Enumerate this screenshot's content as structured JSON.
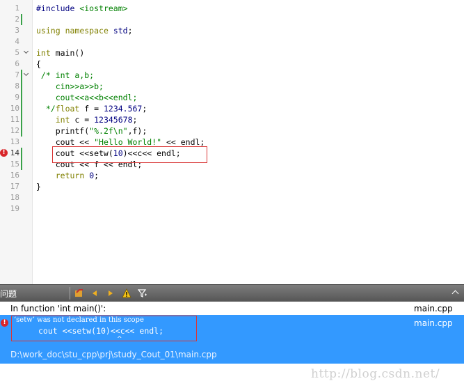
{
  "editor": {
    "lines": [
      {
        "n": "1",
        "code": "#include <iostream>"
      },
      {
        "n": "2",
        "code": ""
      },
      {
        "n": "3",
        "code": "using namespace std;"
      },
      {
        "n": "4",
        "code": ""
      },
      {
        "n": "5",
        "code": "int main()"
      },
      {
        "n": "6",
        "code": "{"
      },
      {
        "n": "7",
        "code": " /* int a,b;"
      },
      {
        "n": "8",
        "code": "    cin>>a>>b;"
      },
      {
        "n": "9",
        "code": "    cout<<a<<b<<endl;"
      },
      {
        "n": "10",
        "code": "  */float f = 1234.567;"
      },
      {
        "n": "11",
        "code": "    int c = 12345678;"
      },
      {
        "n": "12",
        "code": "    printf(\"%.2f\\n\",f);"
      },
      {
        "n": "13",
        "code": "    cout << \"Hello World!\" << endl;"
      },
      {
        "n": "14",
        "code": "    cout <<setw(10)<<c<< endl;"
      },
      {
        "n": "15",
        "code": "    cout << f << endl;"
      },
      {
        "n": "16",
        "code": "    return 0;"
      },
      {
        "n": "17",
        "code": "}"
      },
      {
        "n": "18",
        "code": ""
      },
      {
        "n": "19",
        "code": ""
      }
    ]
  },
  "panel": {
    "title": "问题",
    "rows": {
      "context": "In function 'int main()':",
      "context_file": "main.cpp",
      "error_message": "‘setw’ was not declared in this scope",
      "error_source": "cout <<setw(10)<<c<< endl;",
      "error_caret": "^",
      "error_file": "main.cpp",
      "path": "D:\\work_doc\\stu_cpp\\prj\\study_Cout_01\\main.cpp"
    },
    "icons": [
      "filter-errors-icon",
      "prev-arrow-icon",
      "next-arrow-icon",
      "warning-icon",
      "filter-icon",
      "collapse-icon"
    ]
  },
  "watermark": "http://blog.csdn.net/",
  "colors": {
    "selection": "#3399ff",
    "error": "#d8262a",
    "keyword": "#808000",
    "string": "#008000"
  }
}
